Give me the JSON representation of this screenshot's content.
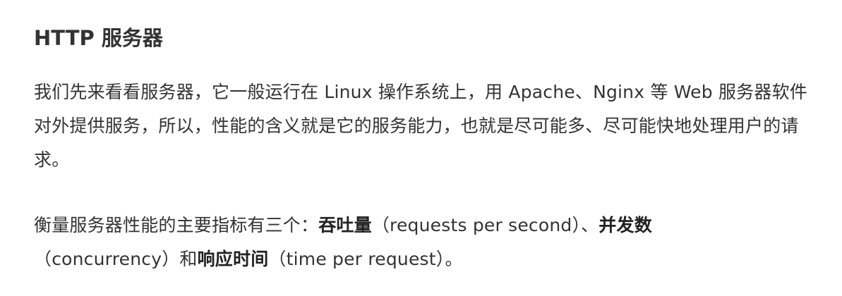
{
  "article": {
    "heading": "HTTP 服务器",
    "paragraph_1": "我们先来看看服务器，它一般运行在 Linux 操作系统上，用 Apache、Nginx 等 Web 服务器软件对外提供服务，所以，性能的含义就是它的服务能力，也就是尽可能多、尽可能快地处理用户的请求。",
    "paragraph_2": {
      "lead": "衡量服务器性能的主要指标有三个：",
      "metric_1_term": "吞吐量",
      "metric_1_note": "（requests per second）、",
      "metric_2_term": "并发数",
      "metric_2_note": "（concurrency）和",
      "metric_3_term": "响应时间",
      "metric_3_note": "（time per request）。"
    }
  }
}
